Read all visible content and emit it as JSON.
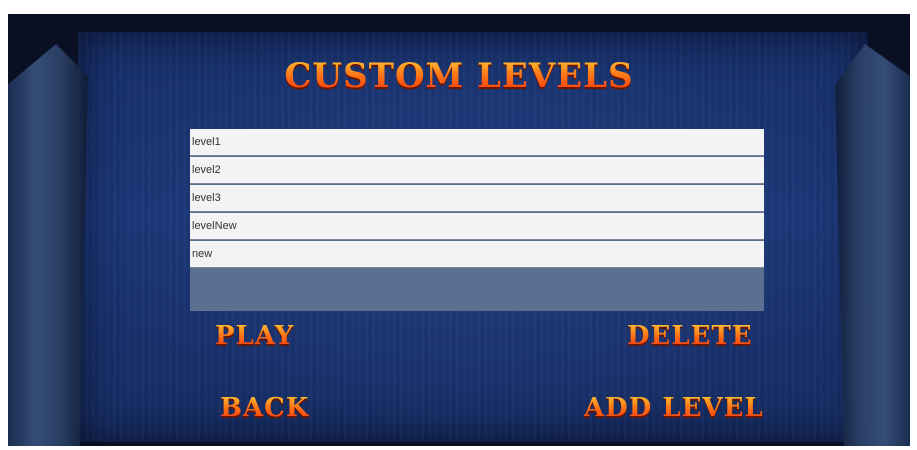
{
  "screen": {
    "title": "CUSTOM LEVELS"
  },
  "levels": [
    {
      "label": "level1"
    },
    {
      "label": "level2"
    },
    {
      "label": "level3"
    },
    {
      "label": "levelNew"
    },
    {
      "label": "new"
    }
  ],
  "buttons": {
    "play": "PLAY",
    "delete": "DELETE",
    "back": "BACK",
    "add_level": "ADD LEVEL"
  },
  "colors": {
    "background": "#0a1024",
    "panel": "#1b3676",
    "title_top": "#ffd23a",
    "title_bottom": "#ff2b0a",
    "list_item": "#f3f3f5",
    "list_empty": "#5d6f91"
  }
}
